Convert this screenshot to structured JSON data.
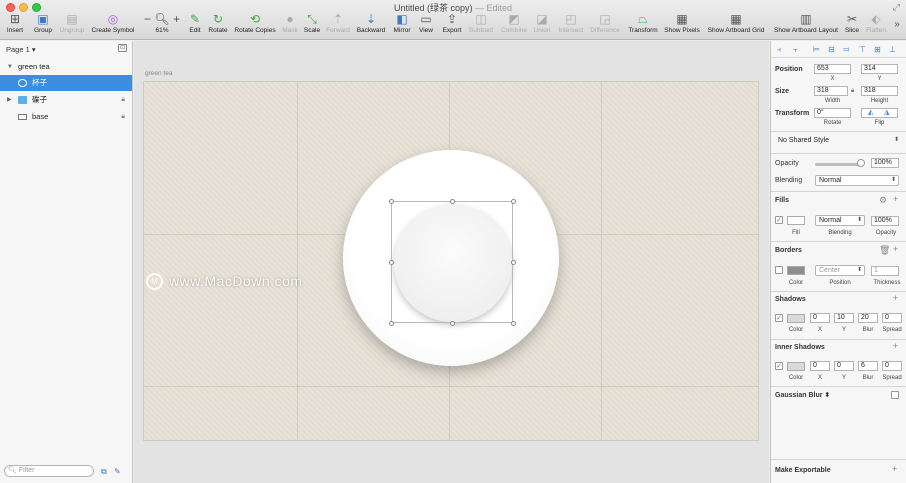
{
  "window": {
    "title": "Untitled (绿茶 copy)",
    "status": " — Edited"
  },
  "toolbar": {
    "items": [
      {
        "label": "Insert",
        "icon": "plus-icon",
        "enabled": true
      },
      {
        "label": "Group",
        "icon": "group-icon",
        "enabled": true
      },
      {
        "label": "Ungroup",
        "icon": "ungroup-icon",
        "enabled": false
      },
      {
        "label": "Create Symbol",
        "icon": "symbol-icon",
        "enabled": true
      },
      {
        "label": "61%",
        "icon": "zoom-icon",
        "enabled": true
      },
      {
        "label": "Edit",
        "icon": "edit-icon",
        "enabled": true
      },
      {
        "label": "Rotate",
        "icon": "rotate-icon",
        "enabled": true
      },
      {
        "label": "Rotate Copies",
        "icon": "rotate-copies-icon",
        "enabled": true
      },
      {
        "label": "Mask",
        "icon": "mask-icon",
        "enabled": false
      },
      {
        "label": "Scale",
        "icon": "scale-icon",
        "enabled": true
      },
      {
        "label": "Forward",
        "icon": "forward-icon",
        "enabled": false
      },
      {
        "label": "Backward",
        "icon": "backward-icon",
        "enabled": true
      },
      {
        "label": "Mirror",
        "icon": "mirror-icon",
        "enabled": true
      },
      {
        "label": "View",
        "icon": "view-icon",
        "enabled": true
      },
      {
        "label": "Export",
        "icon": "export-icon",
        "enabled": true
      },
      {
        "label": "Subtract",
        "icon": "subtract-icon",
        "enabled": false
      },
      {
        "label": "Combine",
        "icon": "combine-icon",
        "enabled": false
      },
      {
        "label": "Union",
        "icon": "union-icon",
        "enabled": false
      },
      {
        "label": "Intersect",
        "icon": "intersect-icon",
        "enabled": false
      },
      {
        "label": "Difference",
        "icon": "difference-icon",
        "enabled": false
      },
      {
        "label": "Transform",
        "icon": "transform-icon",
        "enabled": true
      },
      {
        "label": "Show Pixels",
        "icon": "pixels-icon",
        "enabled": true
      },
      {
        "label": "Show Artboard Grid",
        "icon": "grid-icon",
        "enabled": true
      },
      {
        "label": "Show Artboard Layout",
        "icon": "layout-icon",
        "enabled": true
      },
      {
        "label": "Slice",
        "icon": "slice-icon",
        "enabled": true
      },
      {
        "label": "Flatten",
        "icon": "flatten-icon",
        "enabled": false
      }
    ],
    "overflow": "»"
  },
  "sidebar": {
    "page": "Page 1",
    "layers": [
      {
        "label": "green tea",
        "type": "artboard",
        "selected": false
      },
      {
        "label": "杯子",
        "type": "oval",
        "selected": true
      },
      {
        "label": "碟子",
        "type": "group",
        "selected": false
      },
      {
        "label": "base",
        "type": "rectangle",
        "selected": false
      }
    ],
    "filter_placeholder": "Filter"
  },
  "canvas": {
    "artboard_name": "green tea",
    "watermark": "www.MacDown.com"
  },
  "inspector": {
    "position": {
      "label": "Position",
      "x": "653",
      "y": "314",
      "x_label": "X",
      "y_label": "Y"
    },
    "size": {
      "label": "Size",
      "width": "318",
      "height": "318",
      "w_label": "Width",
      "h_label": "Height"
    },
    "transform": {
      "label": "Transform",
      "rotate": "0°",
      "rotate_label": "Rotate",
      "flip_label": "Flip"
    },
    "shared_style": "No Shared Style",
    "opacity": {
      "label": "Opacity",
      "value": "100%",
      "level": 1.0
    },
    "blending": {
      "label": "Blending",
      "value": "Normal"
    },
    "fills": {
      "title": "Fills",
      "blending": "Normal",
      "opacity": "100%",
      "fill_label": "Fill",
      "blending_label": "Blending",
      "opacity_label": "Opacity",
      "enabled": true
    },
    "borders": {
      "title": "Borders",
      "position": "Center",
      "thickness": "1",
      "color_label": "Color",
      "position_label": "Position",
      "thickness_label": "Thickness",
      "enabled": false
    },
    "shadows": {
      "title": "Shadows",
      "x": "0",
      "y": "10",
      "blur": "20",
      "spread": "0",
      "color_label": "Color",
      "x_label": "X",
      "y_label": "Y",
      "blur_label": "Blur",
      "spread_label": "Spread",
      "enabled": true
    },
    "inner_shadows": {
      "title": "Inner Shadows",
      "x": "0",
      "y": "0",
      "blur": "6",
      "spread": "0",
      "color_label": "Color",
      "x_label": "X",
      "y_label": "Y",
      "blur_label": "Blur",
      "spread_label": "Spread",
      "enabled": true
    },
    "gaussian_blur": "Gaussian Blur",
    "make_exportable": "Make Exportable"
  },
  "colors": {
    "selection": "#3b8ee0",
    "accent": "#3d79c8",
    "artboard_bg": "#e6e0d4"
  }
}
